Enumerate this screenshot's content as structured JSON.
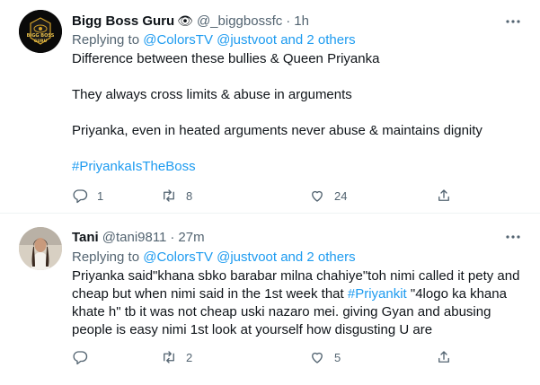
{
  "tweets": [
    {
      "name": "Bigg Boss Guru",
      "name_emoji": "👁",
      "handle": "@_biggbossfc",
      "time": "1h",
      "avatar_text": "BIGG BOSS GURU",
      "replying_to_label": "Replying to",
      "replying_to_mentions": "@ColorsTV @justvoot",
      "replying_to_others": "and 2 others",
      "lines": [
        "Difference between these bullies & Queen Priyanka",
        "They always cross limits & abuse in arguments",
        "Priyanka, even in heated arguments never abuse & maintains dignity"
      ],
      "hashtag": "#PriyankaIsTheBoss",
      "reply_count": "1",
      "retweet_count": "8",
      "like_count": "24"
    },
    {
      "name": "Tani",
      "handle": "@tani9811",
      "time": "27m",
      "replying_to_label": "Replying to",
      "replying_to_mentions": "@ColorsTV @justvoot",
      "replying_to_others": "and 2 others",
      "text_line1": "Priyanka said\"khana sbko barabar milna chahiye\"toh nimi called it pety and",
      "text_line2_a": "cheap but when nimi said in the 1st week that",
      "text_line2_hashtag": "#Priyankit",
      "text_line2_b": "\"4logo ka khana",
      "text_line3": "khate h\" tb it was not cheap uski nazaro mei. giving Gyan and abusing",
      "text_line4": "people is easy nimi 1st look at yourself how disgusting U are",
      "retweet_count": "2",
      "like_count": "5"
    }
  ],
  "colors": {
    "link": "#1d9bf0",
    "secondary_text": "#536471",
    "primary_text": "#0f1419",
    "divider": "#eff3f4"
  }
}
